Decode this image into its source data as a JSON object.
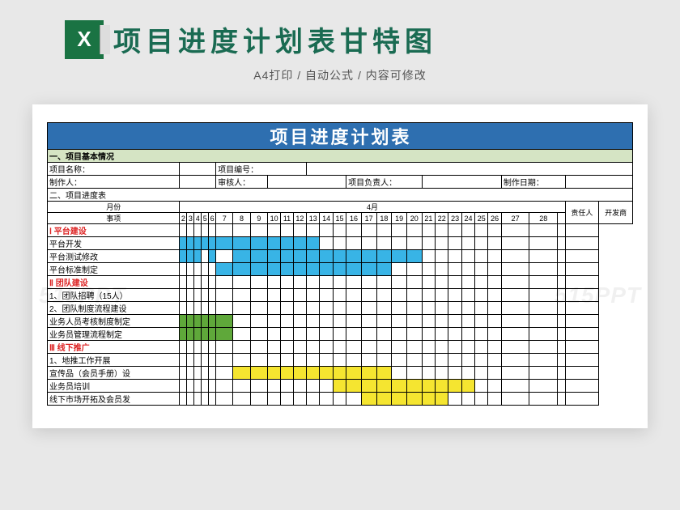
{
  "header": {
    "title": "项目进度计划表甘特图",
    "subtitle": "A4打印 / 自动公式 / 内容可修改"
  },
  "watermark": "515PPT",
  "sheet": {
    "banner": "项目进度计划表",
    "section1": "一、项目基本情况",
    "info": {
      "name_label": "项目名称：",
      "code_label": "项目编号：",
      "maker_label": "制作人：",
      "reviewer_label": "审核人：",
      "leader_label": "项目负责人：",
      "date_label": "制作日期："
    },
    "section2": "二、项目进度表",
    "month_label": "月份",
    "month_value": "4月",
    "item_label": "事项",
    "resp_label": "责任人",
    "dev_label": "开发商",
    "days": [
      "2",
      "3",
      "4",
      "5",
      "6",
      "7",
      "8",
      "9",
      "10",
      "11",
      "12",
      "13",
      "14",
      "15",
      "16",
      "17",
      "18",
      "19",
      "20",
      "21",
      "22",
      "23",
      "24",
      "25",
      "26",
      "27",
      "28"
    ],
    "groups": {
      "g1": "Ⅰ 平台建设",
      "g1r1": "平台开发",
      "g1r2": "平台测试修改",
      "g1r3": "平台标准制定",
      "g2": "Ⅱ 团队建设",
      "g2r1": "1、团队招聘（15人）",
      "g2r2": "2、团队制度流程建设",
      "g2r3": "业务人员考核制度制定",
      "g2r4": "业务员管理流程制定",
      "g3": "Ⅲ 线下推广",
      "g3r1": "1、地推工作开展",
      "g3r2": "宣传品（会员手册）设",
      "g3r3": "业务员培训",
      "g3r4": "线下市场开拓及会员发"
    }
  },
  "chart_data": {
    "type": "bar",
    "title": "项目进度计划表",
    "xlabel": "4月",
    "ylabel": "事项",
    "categories": [
      2,
      3,
      4,
      5,
      6,
      7,
      8,
      9,
      10,
      11,
      12,
      13,
      14,
      15,
      16,
      17,
      18,
      19,
      20,
      21,
      22,
      23,
      24,
      25,
      26,
      27,
      28
    ],
    "series": [
      {
        "name": "平台开发",
        "group": "平台建设",
        "color": "#38b4e6",
        "start": 2,
        "end": 13
      },
      {
        "name": "平台测试修改",
        "group": "平台建设",
        "color": "#38b4e6",
        "segments": [
          [
            2,
            4
          ],
          [
            6,
            6
          ],
          [
            8,
            20
          ]
        ]
      },
      {
        "name": "平台标准制定",
        "group": "平台建设",
        "color": "#38b4e6",
        "start": 7,
        "end": 18
      },
      {
        "name": "业务人员考核制度制定",
        "group": "团队建设",
        "color": "#5fa83a",
        "start": 2,
        "end": 7
      },
      {
        "name": "业务员管理流程制定",
        "group": "团队建设",
        "color": "#5fa83a",
        "start": 2,
        "end": 7
      },
      {
        "name": "宣传品（会员手册）设",
        "group": "线下推广",
        "color": "#f5e530",
        "start": 8,
        "end": 18
      },
      {
        "name": "业务员培训",
        "group": "线下推广",
        "color": "#f5e530",
        "start": 15,
        "end": 24
      },
      {
        "name": "线下市场开拓及会员发",
        "group": "线下推广",
        "color": "#f5e530",
        "start": 17,
        "end": 22
      }
    ]
  }
}
